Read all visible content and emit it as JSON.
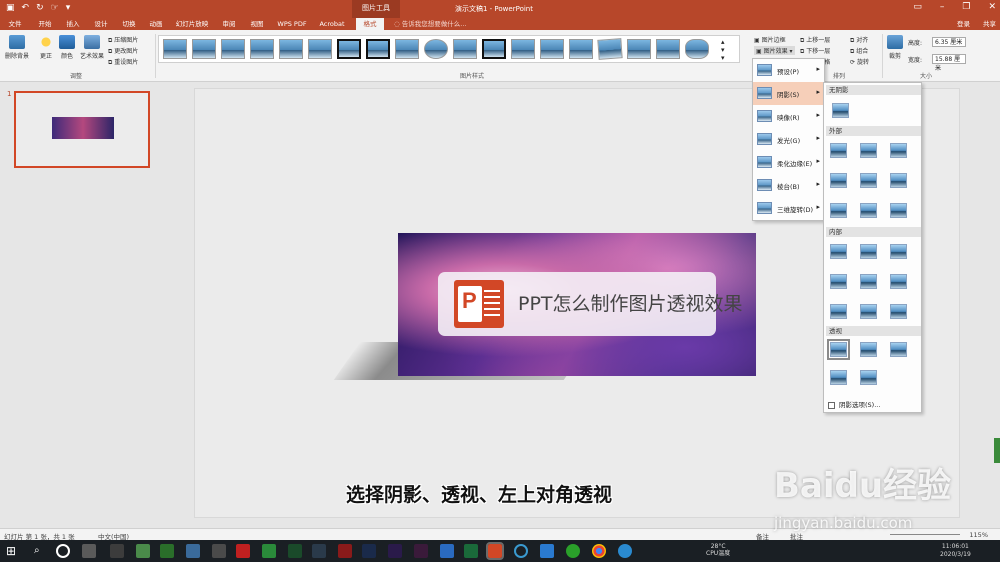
{
  "titlebar": {
    "context_tab": "图片工具",
    "doc_title": "演示文稿1 - PowerPoint",
    "qat_icons": [
      "save-icon",
      "undo-icon",
      "redo-icon",
      "touch-mode-icon",
      "customize-icon"
    ]
  },
  "tabs": [
    "文件",
    "开始",
    "插入",
    "设计",
    "切换",
    "动画",
    "幻灯片放映",
    "审阅",
    "视图",
    "WPS PDF",
    "Acrobat",
    "格式"
  ],
  "active_tab": "格式",
  "tellme": "告诉我您想要做什么...",
  "login": "登录",
  "share": "共享",
  "ribbon": {
    "remove_bg": "删除背景",
    "corrections": "更正",
    "color": "颜色",
    "artistic": "艺术效果",
    "compress": "压缩图片",
    "change": "更改图片",
    "reset": "重设图片",
    "adjust_group": "调整",
    "styles_group": "图片样式",
    "border": "图片边框",
    "effects": "图片效果",
    "bring_forward": "上移一层",
    "send_backward": "下移一层",
    "selection_pane": "选择窗格",
    "align": "对齐",
    "group": "组合",
    "rotate": "旋转",
    "arrange_group": "排列",
    "crop": "裁剪",
    "height_label": "高度:",
    "height_value": "6.35 厘米",
    "width_label": "宽度:",
    "width_value": "15.88 厘米",
    "size_group": "大小"
  },
  "slide_panel": {
    "number": "1"
  },
  "slide": {
    "banner_text": "PPT怎么制作图片透视效果",
    "caption": "选择阴影、透视、左上对角透视"
  },
  "effects_menu": [
    {
      "label": "预设(P)",
      "icon": "preset-icon"
    },
    {
      "label": "阴影(S)",
      "icon": "shadow-icon"
    },
    {
      "label": "映像(R)",
      "icon": "reflection-icon"
    },
    {
      "label": "发光(G)",
      "icon": "glow-icon"
    },
    {
      "label": "柔化边缘(E)",
      "icon": "soft-edges-icon"
    },
    {
      "label": "棱台(B)",
      "icon": "bevel-icon"
    },
    {
      "label": "三维旋转(D)",
      "icon": "3d-rotation-icon"
    }
  ],
  "shadow_submenu": {
    "no_shadow": "无阴影",
    "outer": "外部",
    "inner": "内部",
    "perspective": "透视",
    "options": "阴影选项(S)..."
  },
  "status": {
    "slide_info": "幻灯片 第 1 张，共 1 张",
    "language": "中文(中国)",
    "notes": "备注",
    "comments": "批注",
    "zoom": "115%"
  },
  "taskbar": {
    "temperature": "28°C",
    "cpu": "CPU温度",
    "time": "11:06:01",
    "date": "2020/3/19"
  },
  "watermark": {
    "main": "Baidu经验",
    "sub": "jingyan.baidu.com"
  }
}
